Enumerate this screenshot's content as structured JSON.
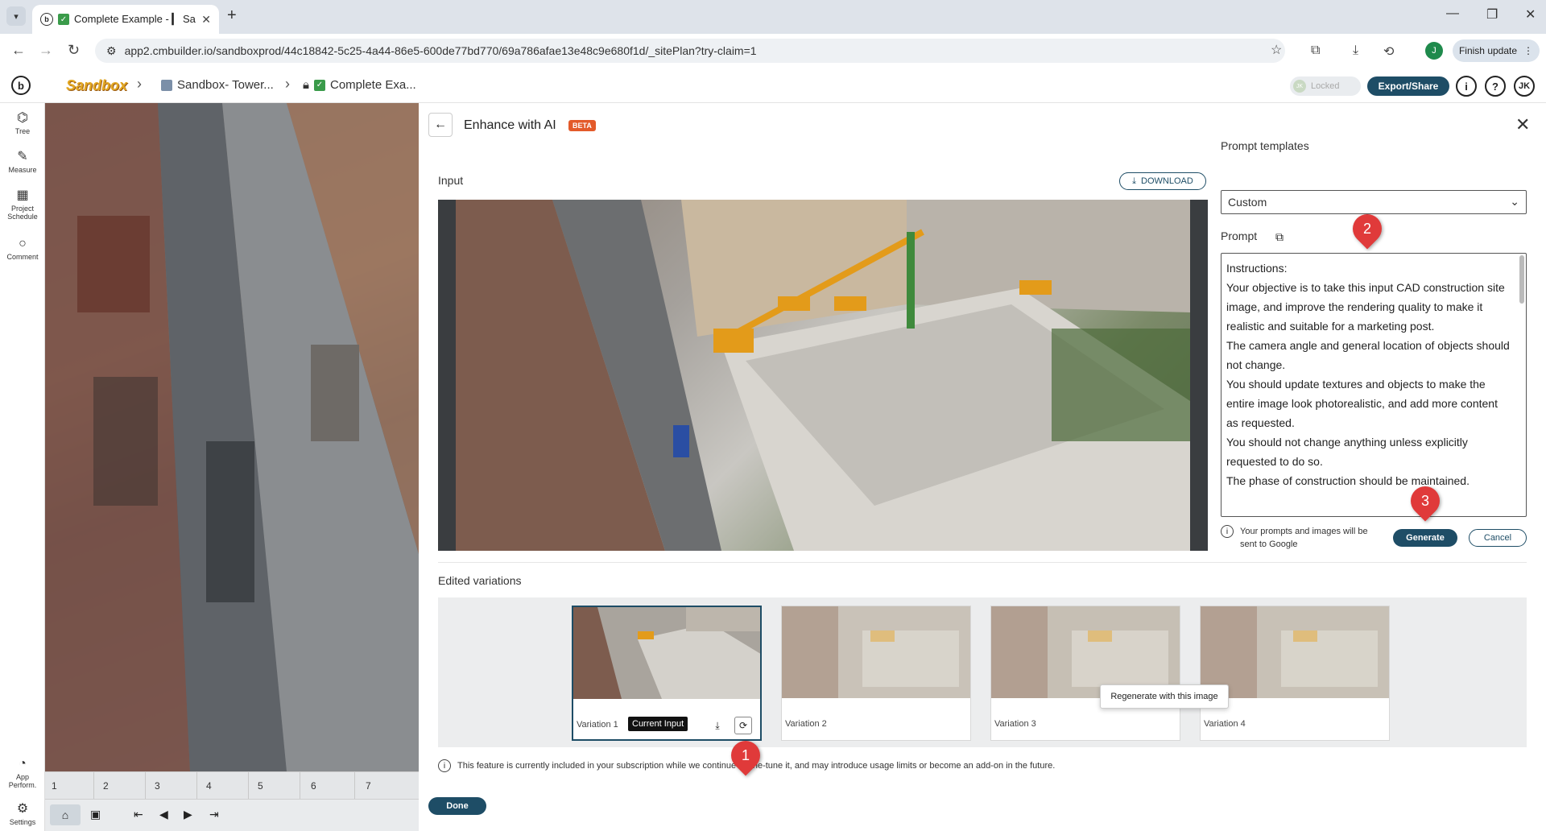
{
  "browser": {
    "tab_title": "Complete Example - ▎ Sa",
    "url": "app2.cmbuilder.io/sandboxprod/44c18842-5c25-4a44-86e5-600de77bd770/69a786afae13e48c9e680f1d/_sitePlan?try-claim=1",
    "profile_initial": "J",
    "finish_update": "Finish update"
  },
  "header": {
    "logo_text": "Sandbox",
    "crumb_1": "Sandbox- Tower...",
    "crumb_2": "Complete Exa...",
    "locked_label": "Locked",
    "export_label": "Export/Share",
    "user_initials": "JK"
  },
  "rail": {
    "tree": "Tree",
    "measure": "Measure",
    "project_schedule_1": "Project",
    "project_schedule_2": "Schedule",
    "comment": "Comment",
    "app_perf_1": "App",
    "app_perf_2": "Perform.",
    "settings": "Settings"
  },
  "timeline": [
    "1",
    "2",
    "3",
    "4",
    "5",
    "6",
    "7"
  ],
  "modal": {
    "title": "Enhance with AI",
    "beta": "BETA",
    "input_label": "Input",
    "download": "DOWNLOAD",
    "prompt_templates_label": "Prompt templates",
    "template_value": "Custom",
    "prompt_label": "Prompt",
    "prompt_lines": [
      "Instructions:",
      "Your objective is to take this input CAD construction site image, and improve the rendering quality to make it realistic and suitable for a marketing post.",
      "The camera angle and general location of objects should not change.",
      "You should update textures and objects to make the entire image look photorealistic, and add more content as requested.",
      "You should not change anything unless explicitly requested to do so.",
      "The phase of construction should be maintained."
    ],
    "privacy_note_1": "Your prompts and images will be",
    "privacy_note_2": "sent to Google",
    "generate": "Generate",
    "cancel": "Cancel",
    "edited_variations_label": "Edited variations",
    "variations": [
      "Variation 1",
      "Variation 2",
      "Variation 3",
      "Variation 4"
    ],
    "current_input_badge": "Current Input",
    "tooltip": "Regenerate with this image",
    "subscription_note": "This feature is currently included in your subscription while we continue to fine-tune it, and may introduce usage limits or become an add-on in the future.",
    "done": "Done"
  },
  "annotations": [
    "1",
    "2",
    "3"
  ],
  "colors": {
    "primary": "#1e4d66",
    "beta": "#e35a2a",
    "pin": "#e03a3a"
  }
}
